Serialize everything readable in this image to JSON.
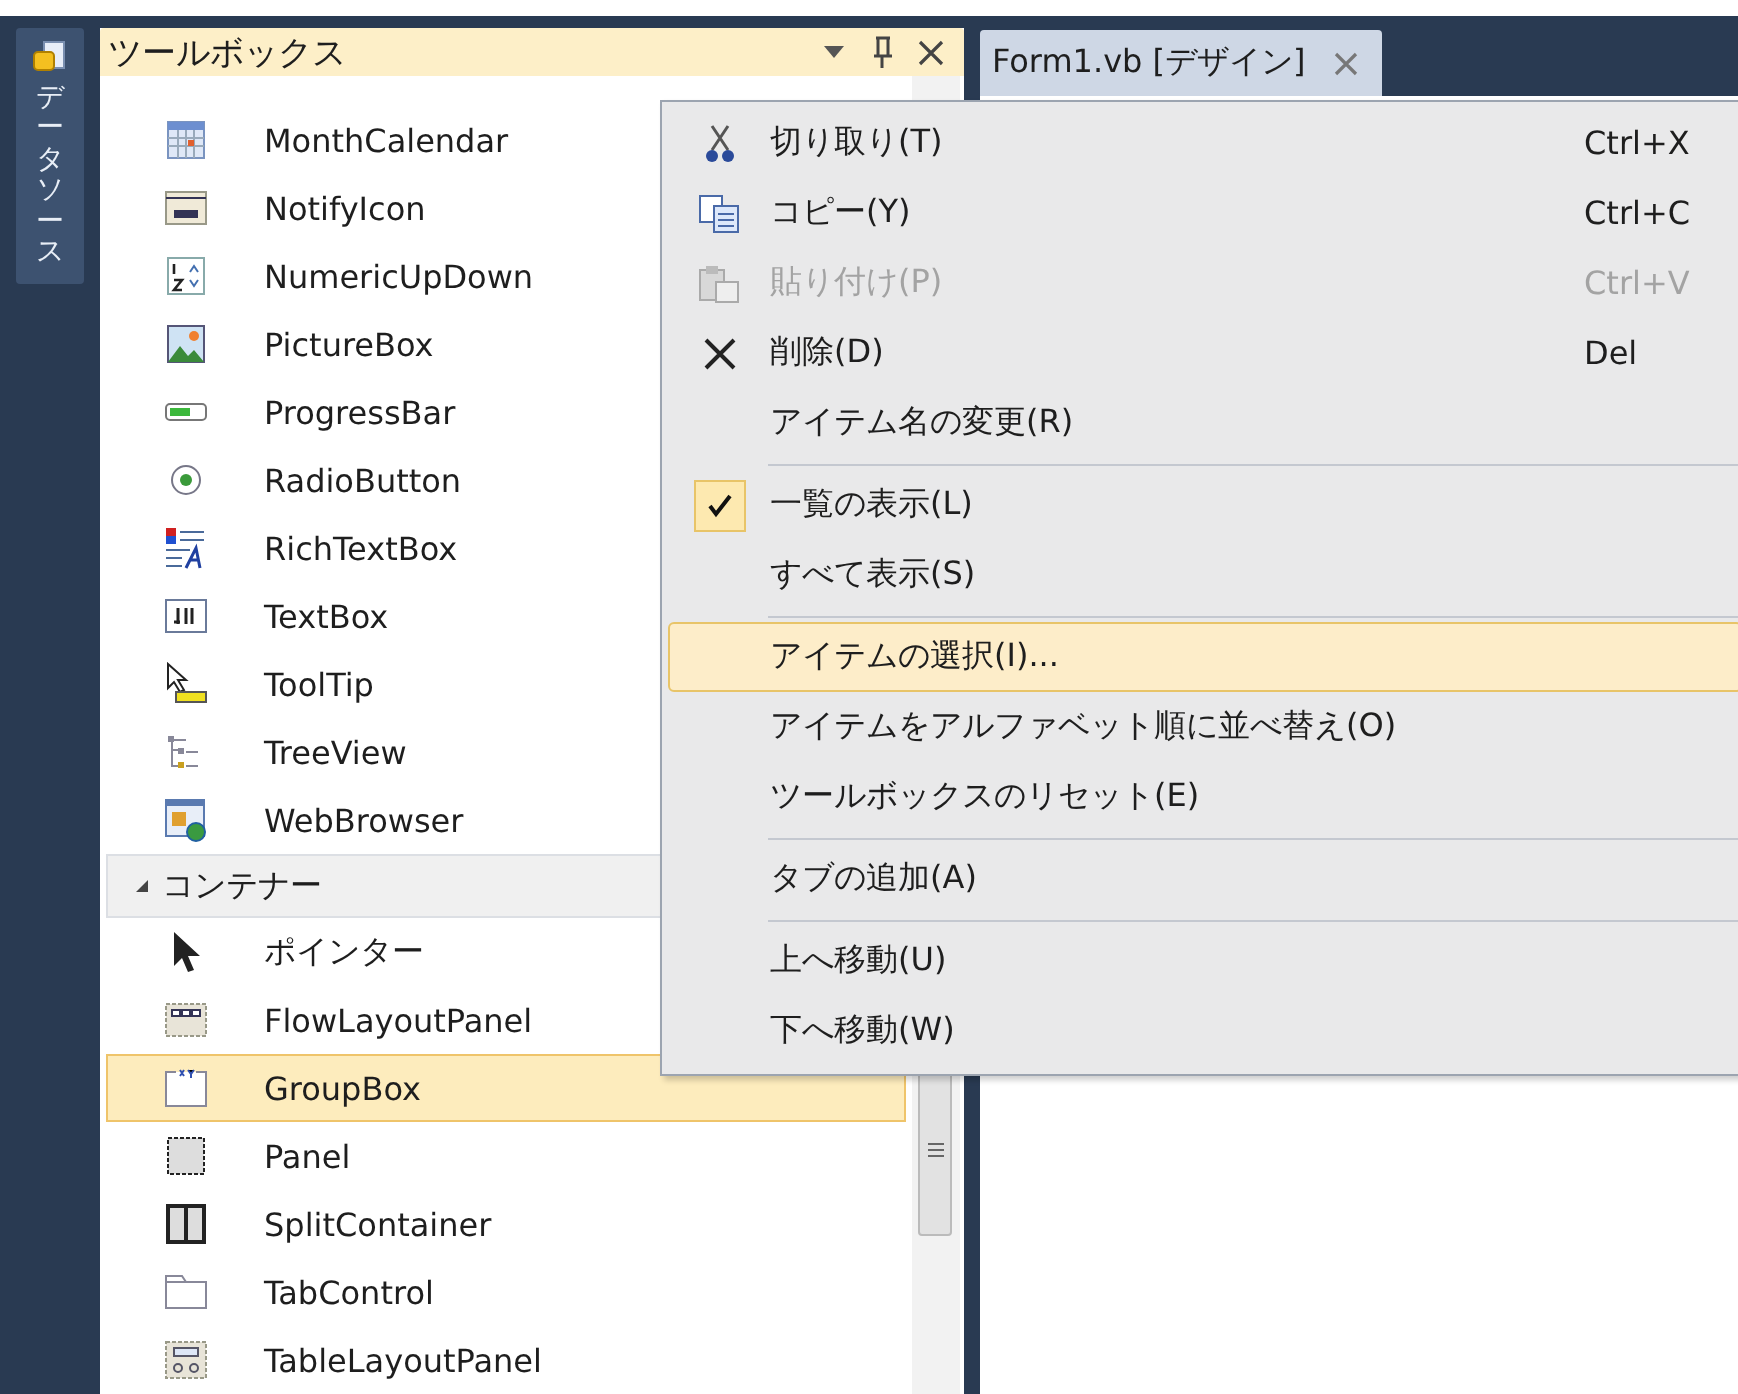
{
  "side_tab": {
    "label": "データソース"
  },
  "toolbox": {
    "title": "ツールボックス",
    "rows": [
      {
        "kind": "tool",
        "label": "MonthCalendar",
        "selected": false
      },
      {
        "kind": "tool",
        "label": "NotifyIcon",
        "selected": false
      },
      {
        "kind": "tool",
        "label": "NumericUpDown",
        "selected": false
      },
      {
        "kind": "tool",
        "label": "PictureBox",
        "selected": false
      },
      {
        "kind": "tool",
        "label": "ProgressBar",
        "selected": false
      },
      {
        "kind": "tool",
        "label": "RadioButton",
        "selected": false
      },
      {
        "kind": "tool",
        "label": "RichTextBox",
        "selected": false
      },
      {
        "kind": "tool",
        "label": "TextBox",
        "selected": false
      },
      {
        "kind": "tool",
        "label": "ToolTip",
        "selected": false
      },
      {
        "kind": "tool",
        "label": "TreeView",
        "selected": false
      },
      {
        "kind": "tool",
        "label": "WebBrowser",
        "selected": false
      },
      {
        "kind": "category",
        "label": "コンテナー",
        "expanded": true
      },
      {
        "kind": "tool",
        "label": "ポインター",
        "selected": false
      },
      {
        "kind": "tool",
        "label": "FlowLayoutPanel",
        "selected": false
      },
      {
        "kind": "tool",
        "label": "GroupBox",
        "selected": true
      },
      {
        "kind": "tool",
        "label": "Panel",
        "selected": false
      },
      {
        "kind": "tool",
        "label": "SplitContainer",
        "selected": false
      },
      {
        "kind": "tool",
        "label": "TabControl",
        "selected": false
      },
      {
        "kind": "tool",
        "label": "TableLayoutPanel",
        "selected": false
      }
    ]
  },
  "document_tabs": [
    {
      "label": "Form1.vb [デザイン]",
      "selected": true
    }
  ],
  "context_menu": [
    {
      "kind": "item",
      "label": "切り取り(T)",
      "shortcut": "Ctrl+X",
      "disabled": false,
      "checked": false,
      "selected": false
    },
    {
      "kind": "item",
      "label": "コピー(Y)",
      "shortcut": "Ctrl+C",
      "disabled": false,
      "checked": false,
      "selected": false
    },
    {
      "kind": "item",
      "label": "貼り付け(P)",
      "shortcut": "Ctrl+V",
      "disabled": true,
      "checked": false,
      "selected": false
    },
    {
      "kind": "item",
      "label": "削除(D)",
      "shortcut": "Del",
      "disabled": false,
      "checked": false,
      "selected": false
    },
    {
      "kind": "item",
      "label": "アイテム名の変更(R)",
      "disabled": false,
      "checked": false,
      "selected": false
    },
    {
      "kind": "separator"
    },
    {
      "kind": "item",
      "label": "一覧の表示(L)",
      "disabled": false,
      "checked": true,
      "selected": false
    },
    {
      "kind": "item",
      "label": "すべて表示(S)",
      "disabled": false,
      "checked": false,
      "selected": false
    },
    {
      "kind": "separator"
    },
    {
      "kind": "item",
      "label": "アイテムの選択(I)...",
      "disabled": false,
      "checked": false,
      "selected": true
    },
    {
      "kind": "item",
      "label": "アイテムをアルファベット順に並べ替え(O)",
      "disabled": false,
      "checked": false,
      "selected": false
    },
    {
      "kind": "item",
      "label": "ツールボックスのリセット(E)",
      "disabled": false,
      "checked": false,
      "selected": false
    },
    {
      "kind": "separator"
    },
    {
      "kind": "item",
      "label": "タブの追加(A)",
      "disabled": false,
      "checked": false,
      "selected": false
    },
    {
      "kind": "separator"
    },
    {
      "kind": "item",
      "label": "上へ移動(U)",
      "disabled": false,
      "checked": false,
      "selected": false
    },
    {
      "kind": "item",
      "label": "下へ移動(W)",
      "disabled": false,
      "checked": false,
      "selected": false
    }
  ]
}
